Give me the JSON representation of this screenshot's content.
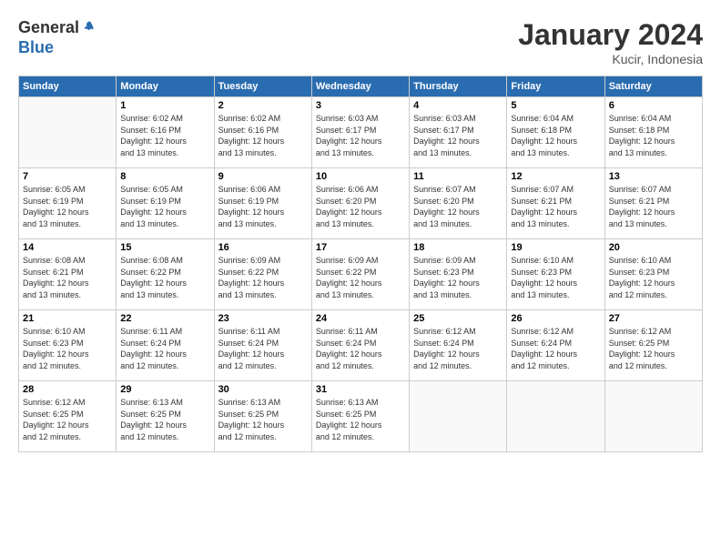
{
  "header": {
    "logo_line1": "General",
    "logo_line2": "Blue",
    "month": "January 2024",
    "location": "Kucir, Indonesia"
  },
  "weekdays": [
    "Sunday",
    "Monday",
    "Tuesday",
    "Wednesday",
    "Thursday",
    "Friday",
    "Saturday"
  ],
  "weeks": [
    [
      {
        "day": "",
        "info": ""
      },
      {
        "day": "1",
        "info": "Sunrise: 6:02 AM\nSunset: 6:16 PM\nDaylight: 12 hours\nand 13 minutes."
      },
      {
        "day": "2",
        "info": "Sunrise: 6:02 AM\nSunset: 6:16 PM\nDaylight: 12 hours\nand 13 minutes."
      },
      {
        "day": "3",
        "info": "Sunrise: 6:03 AM\nSunset: 6:17 PM\nDaylight: 12 hours\nand 13 minutes."
      },
      {
        "day": "4",
        "info": "Sunrise: 6:03 AM\nSunset: 6:17 PM\nDaylight: 12 hours\nand 13 minutes."
      },
      {
        "day": "5",
        "info": "Sunrise: 6:04 AM\nSunset: 6:18 PM\nDaylight: 12 hours\nand 13 minutes."
      },
      {
        "day": "6",
        "info": "Sunrise: 6:04 AM\nSunset: 6:18 PM\nDaylight: 12 hours\nand 13 minutes."
      }
    ],
    [
      {
        "day": "7",
        "info": "Sunrise: 6:05 AM\nSunset: 6:19 PM\nDaylight: 12 hours\nand 13 minutes."
      },
      {
        "day": "8",
        "info": "Sunrise: 6:05 AM\nSunset: 6:19 PM\nDaylight: 12 hours\nand 13 minutes."
      },
      {
        "day": "9",
        "info": "Sunrise: 6:06 AM\nSunset: 6:19 PM\nDaylight: 12 hours\nand 13 minutes."
      },
      {
        "day": "10",
        "info": "Sunrise: 6:06 AM\nSunset: 6:20 PM\nDaylight: 12 hours\nand 13 minutes."
      },
      {
        "day": "11",
        "info": "Sunrise: 6:07 AM\nSunset: 6:20 PM\nDaylight: 12 hours\nand 13 minutes."
      },
      {
        "day": "12",
        "info": "Sunrise: 6:07 AM\nSunset: 6:21 PM\nDaylight: 12 hours\nand 13 minutes."
      },
      {
        "day": "13",
        "info": "Sunrise: 6:07 AM\nSunset: 6:21 PM\nDaylight: 12 hours\nand 13 minutes."
      }
    ],
    [
      {
        "day": "14",
        "info": "Sunrise: 6:08 AM\nSunset: 6:21 PM\nDaylight: 12 hours\nand 13 minutes."
      },
      {
        "day": "15",
        "info": "Sunrise: 6:08 AM\nSunset: 6:22 PM\nDaylight: 12 hours\nand 13 minutes."
      },
      {
        "day": "16",
        "info": "Sunrise: 6:09 AM\nSunset: 6:22 PM\nDaylight: 12 hours\nand 13 minutes."
      },
      {
        "day": "17",
        "info": "Sunrise: 6:09 AM\nSunset: 6:22 PM\nDaylight: 12 hours\nand 13 minutes."
      },
      {
        "day": "18",
        "info": "Sunrise: 6:09 AM\nSunset: 6:23 PM\nDaylight: 12 hours\nand 13 minutes."
      },
      {
        "day": "19",
        "info": "Sunrise: 6:10 AM\nSunset: 6:23 PM\nDaylight: 12 hours\nand 13 minutes."
      },
      {
        "day": "20",
        "info": "Sunrise: 6:10 AM\nSunset: 6:23 PM\nDaylight: 12 hours\nand 12 minutes."
      }
    ],
    [
      {
        "day": "21",
        "info": "Sunrise: 6:10 AM\nSunset: 6:23 PM\nDaylight: 12 hours\nand 12 minutes."
      },
      {
        "day": "22",
        "info": "Sunrise: 6:11 AM\nSunset: 6:24 PM\nDaylight: 12 hours\nand 12 minutes."
      },
      {
        "day": "23",
        "info": "Sunrise: 6:11 AM\nSunset: 6:24 PM\nDaylight: 12 hours\nand 12 minutes."
      },
      {
        "day": "24",
        "info": "Sunrise: 6:11 AM\nSunset: 6:24 PM\nDaylight: 12 hours\nand 12 minutes."
      },
      {
        "day": "25",
        "info": "Sunrise: 6:12 AM\nSunset: 6:24 PM\nDaylight: 12 hours\nand 12 minutes."
      },
      {
        "day": "26",
        "info": "Sunrise: 6:12 AM\nSunset: 6:24 PM\nDaylight: 12 hours\nand 12 minutes."
      },
      {
        "day": "27",
        "info": "Sunrise: 6:12 AM\nSunset: 6:25 PM\nDaylight: 12 hours\nand 12 minutes."
      }
    ],
    [
      {
        "day": "28",
        "info": "Sunrise: 6:12 AM\nSunset: 6:25 PM\nDaylight: 12 hours\nand 12 minutes."
      },
      {
        "day": "29",
        "info": "Sunrise: 6:13 AM\nSunset: 6:25 PM\nDaylight: 12 hours\nand 12 minutes."
      },
      {
        "day": "30",
        "info": "Sunrise: 6:13 AM\nSunset: 6:25 PM\nDaylight: 12 hours\nand 12 minutes."
      },
      {
        "day": "31",
        "info": "Sunrise: 6:13 AM\nSunset: 6:25 PM\nDaylight: 12 hours\nand 12 minutes."
      },
      {
        "day": "",
        "info": ""
      },
      {
        "day": "",
        "info": ""
      },
      {
        "day": "",
        "info": ""
      }
    ]
  ]
}
